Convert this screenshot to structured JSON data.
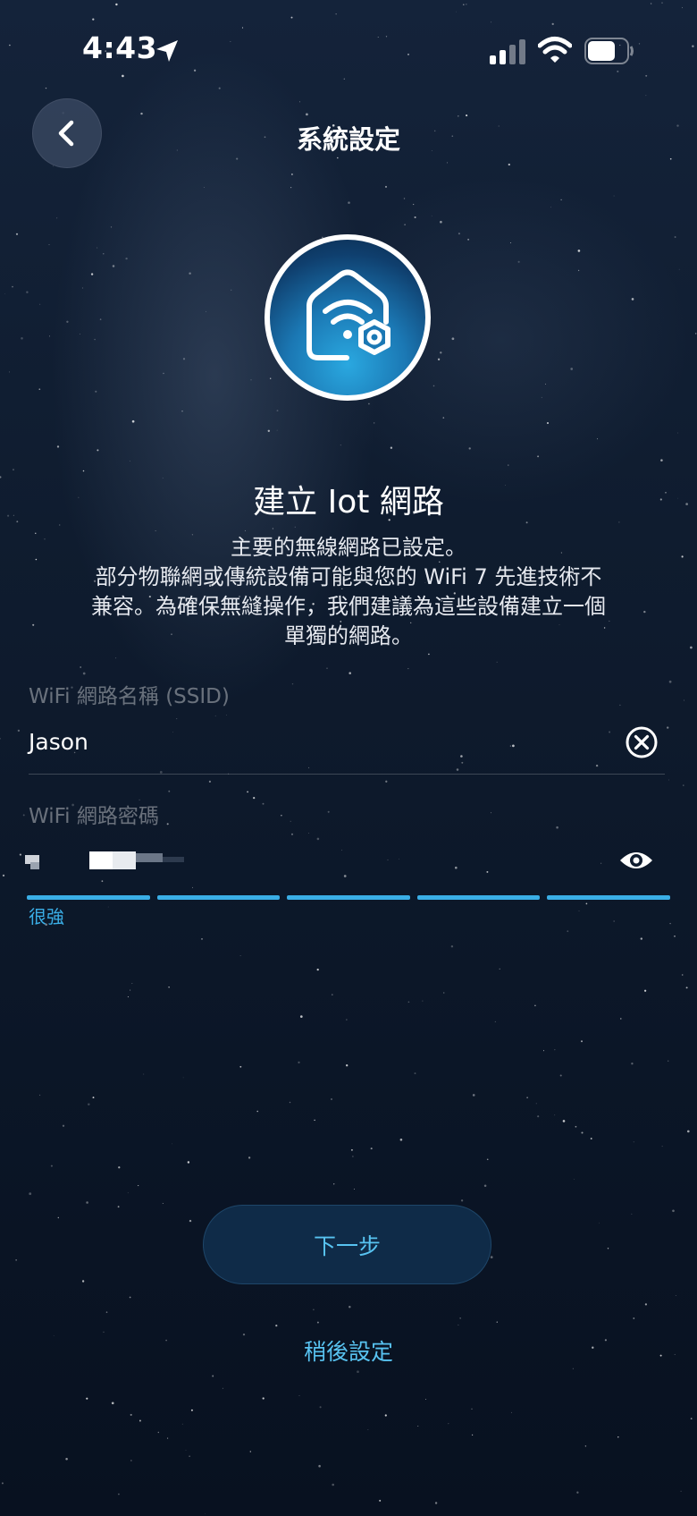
{
  "status_bar": {
    "time": "4:43"
  },
  "header": {
    "title": "系統設定"
  },
  "icons": {
    "back": "chevron-left-icon",
    "hero": "home-wifi-settings-icon",
    "clear": "clear-circle-icon",
    "eye": "eye-icon",
    "location": "location-arrow-icon",
    "signal": "cellular-signal-icon",
    "wifi": "wifi-icon",
    "battery": "battery-icon"
  },
  "main": {
    "heading": "建立 Iot 網路",
    "description_lines": [
      "主要的無線網路已設定。",
      "部分物聯網或傳統設備可能與您的 WiFi 7 先進技術不",
      "兼容。為確保無縫操作，我們建議為這些設備建立一個",
      "單獨的網路。"
    ]
  },
  "form": {
    "ssid": {
      "label": "WiFi 網路名稱 (SSID)",
      "value": "Jason"
    },
    "password": {
      "label": "WiFi 網路密碼",
      "strength_label": "很強",
      "strength_level": 1.0
    }
  },
  "actions": {
    "next_label": "下一步",
    "later_label": "稍後設定"
  },
  "colors": {
    "accent": "#3aaee6",
    "link": "#58c3f1",
    "button_bg": "#0f2b48",
    "background": "#0f1c2f"
  }
}
